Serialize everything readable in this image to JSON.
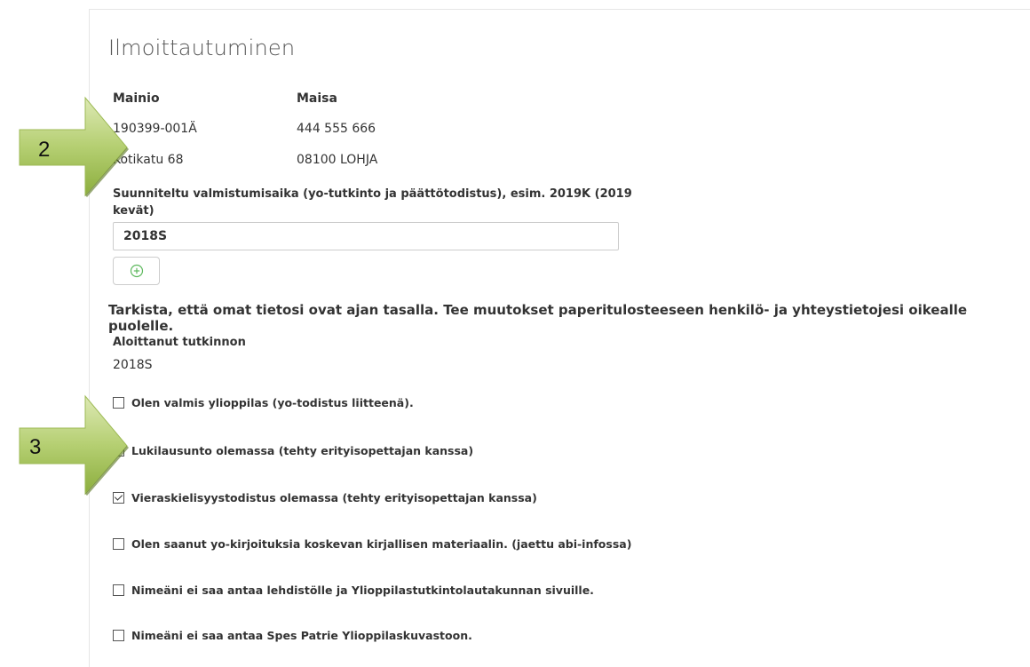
{
  "page": {
    "title": "Ilmoittautuminen"
  },
  "person": {
    "last_name": "Mainio",
    "first_name": "Maisa",
    "ssn": "190399-001Ä",
    "phone": "444 555 666",
    "street": "Kotikatu 68",
    "postal": "08100 LOHJA"
  },
  "graduation": {
    "label_line1": "Suunniteltu valmistumisaika (yo-tutkinto ja päättötodistus), esim. 2019K (2019",
    "label_line2": "kevät)",
    "value": "2018S",
    "add_icon": "plus-circle-icon"
  },
  "notice": "Tarkista, että omat tietosi ovat ajan tasalla. Tee muutokset paperitulosteeseen henkilö- ja yhteystietojesi oikealle puolelle.",
  "started": {
    "label": "Aloittanut tutkinnon",
    "value": "2018S"
  },
  "checkboxes": [
    {
      "label": "Olen valmis ylioppilas (yo-todistus liitteenä).",
      "checked": false
    },
    {
      "label": "Lukilausunto olemassa (tehty erityisopettajan kanssa)",
      "checked": true
    },
    {
      "label": "Vieraskielisyystodistus olemassa (tehty erityisopettajan kanssa)",
      "checked": true
    },
    {
      "label": "Olen saanut yo-kirjoituksia koskevan kirjallisen materiaalin. (jaettu abi-infossa)",
      "checked": false
    },
    {
      "label": "Nimeäni ei saa antaa lehdistölle ja Ylioppilastutkintolautakunnan sivuille.",
      "checked": false
    },
    {
      "label": "Nimeäni ei saa antaa Spes Patrie Ylioppilaskuvastoon.",
      "checked": false
    }
  ],
  "callouts": [
    {
      "number": "2"
    },
    {
      "number": "3"
    }
  ],
  "colors": {
    "callout_green_light": "#c8dc8c",
    "callout_green_dark": "#8cae3e",
    "border": "#cccccc",
    "add_icon": "#5cb85c"
  }
}
